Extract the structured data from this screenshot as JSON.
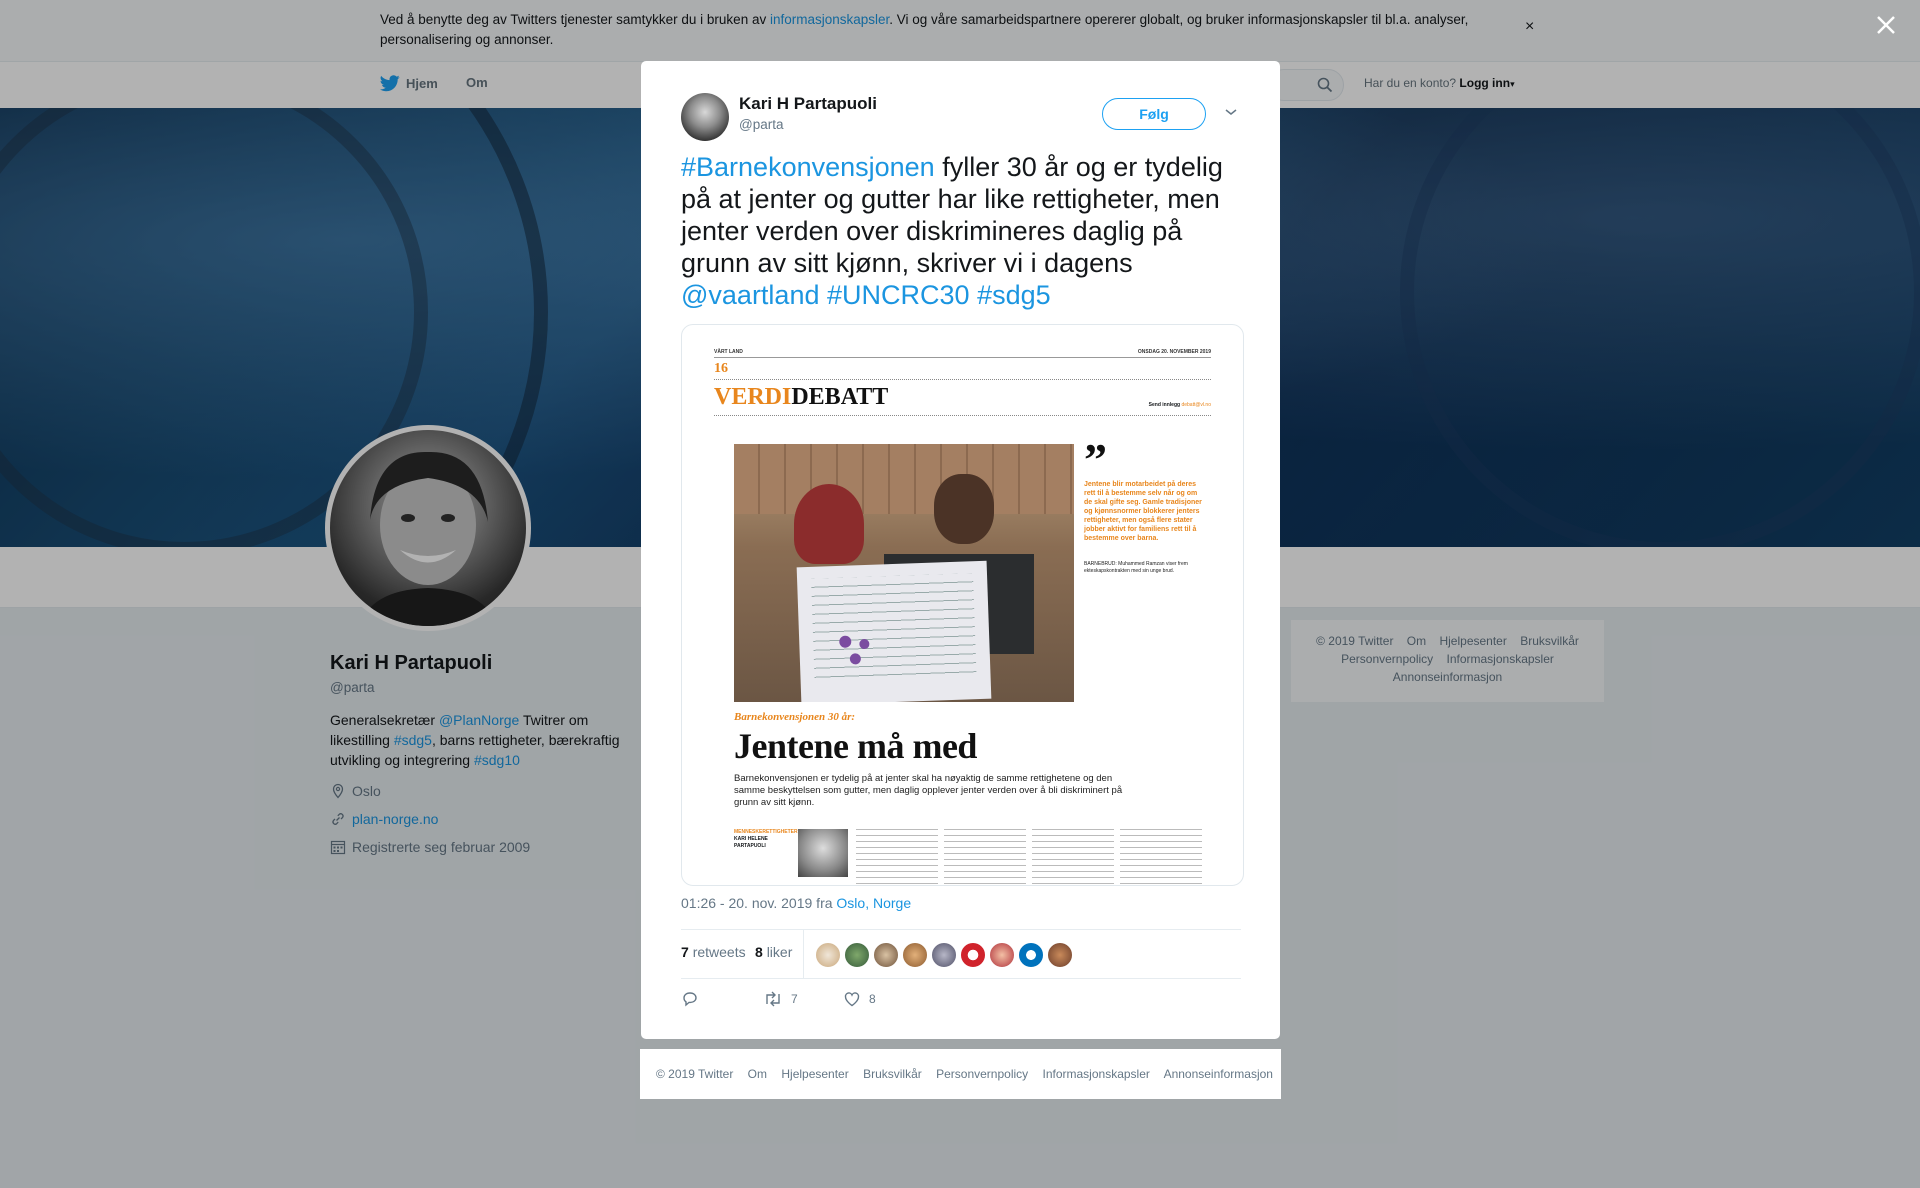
{
  "cookie": {
    "text_before": "Ved å benytte deg av Twitters tjenester samtykker du i bruken av ",
    "link": "informasjonskapsler",
    "text_after": ". Vi og våre samarbeidspartnere opererer globalt, og bruker informasjonskapsler til bl.a. analyser, personalisering og annonser.",
    "close": "×"
  },
  "nav": {
    "home": "Hjem",
    "about": "Om",
    "account_prompt": "Har du en konto?",
    "login": "Logg inn"
  },
  "profile": {
    "name": "Kari H Partapuoli",
    "handle": "@parta",
    "bio_1": "Generalsekretær ",
    "bio_mention": "@PlanNorge",
    "bio_2": " Twitrer om likestilling ",
    "bio_tag1": "#sdg5",
    "bio_3": ", barns rettigheter, bærekraftig utvikling og integrering ",
    "bio_tag2": "#sdg10",
    "location": "Oslo",
    "website": "plan-norge.no",
    "joined": "Registrerte seg februar 2009"
  },
  "side_footer": {
    "row1": [
      "© 2019 Twitter",
      "Om",
      "Hjelpesenter",
      "Bruksvilkår"
    ],
    "row2": [
      "Personvernpolicy",
      "Informasjonskapsler"
    ],
    "row3": [
      "Annonseinformasjon"
    ]
  },
  "tweet": {
    "name": "Kari H Partapuoli",
    "handle": "@parta",
    "follow": "Følg",
    "hashtag1": "#Barnekonvensjonen",
    "body": " fyller 30 år og er tydelig på at jenter og gutter har like rettigheter, men jenter verden over diskrimineres daglig på grunn av sitt kjønn, skriver vi i dagens ",
    "mention": "@vaartland",
    "hashtag2": "#UNCRC30",
    "hashtag3": "#sdg5",
    "time": "01:26 - 20. nov. 2019 fra ",
    "place": "Oslo, Norge",
    "retweets_count": "7",
    "retweets_label": "retweets",
    "likes_count": "8",
    "likes_label": "liker",
    "action_retweets": "7",
    "action_likes": "8"
  },
  "newspaper": {
    "masthead": "VÅRT LAND",
    "date": "ONSDAG 20. NOVEMBER 2019",
    "page": "16",
    "section_1": "VERDI",
    "section_2": "DEBATT",
    "send": "Send innlegg",
    "email": "debatt@vl.no",
    "quote": "Jentene blir motarbeidet på deres rett til å bestemme selv når og om de skal gifte seg. Gamle tradisjoner og kjønnsnormer blokkerer jenters rettigheter, men også flere stater jobber aktivt for familiens rett til å bestemme over barna.",
    "kicker": "Barnekonvensjonen 30 år:",
    "headline": "Jentene må med",
    "lead": "Barnekonvensjonen er tydelig på at jenter skal ha nøyaktig de samme rettighetene og den samme beskyttelsen som gutter, men daglig opplever jenter verden over å bli diskriminert på grunn av sitt kjønn.",
    "byline_label": "MENNESKERETTIGHETER",
    "byline_name": "KARI HELENE PARTAPUOLI",
    "caption": "BARNEBRUD: Muhammed Ramzan viser frem ekteskapskontrakten med sin unge brud."
  },
  "modal_footer": [
    "© 2019 Twitter",
    "Om",
    "Hjelpesenter",
    "Bruksvilkår",
    "Personvernpolicy",
    "Informasjonskapsler",
    "Annonseinformasjon"
  ],
  "colors": {
    "link": "#1b95e0",
    "follow": "#1da1f2",
    "paper_orange": "#e8861d"
  },
  "icons": [
    "twitter-bird-icon",
    "search-icon",
    "location-icon",
    "link-icon",
    "calendar-icon",
    "caret-down-icon",
    "reply-icon",
    "retweet-icon",
    "heart-icon",
    "close-icon"
  ]
}
